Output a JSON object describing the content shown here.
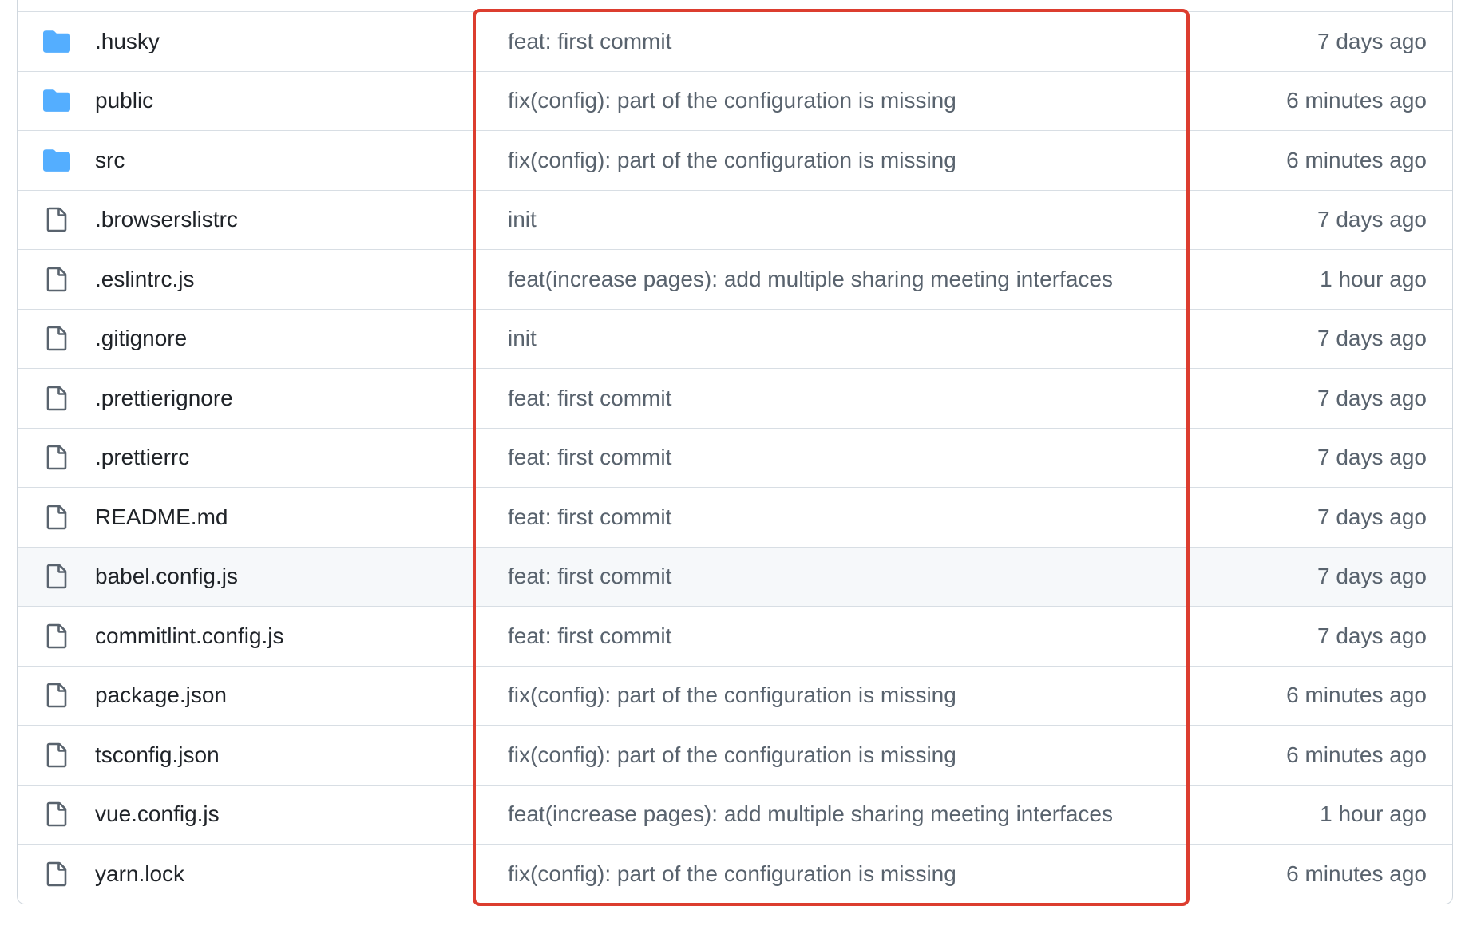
{
  "colors": {
    "folder_icon": "#54aeff",
    "file_icon": "#59636e",
    "highlight_box": "#dc3d2f",
    "row_border": "#d8dee4",
    "hover_row": "#f6f8fa"
  },
  "files": [
    {
      "name": ".husky",
      "type": "folder",
      "icon": "folder-icon",
      "message": "feat: first commit",
      "age": "7 days ago"
    },
    {
      "name": "public",
      "type": "folder",
      "icon": "folder-icon",
      "message": "fix(config): part of the configuration is missing",
      "age": "6 minutes ago"
    },
    {
      "name": "src",
      "type": "folder",
      "icon": "folder-icon",
      "message": "fix(config): part of the configuration is missing",
      "age": "6 minutes ago"
    },
    {
      "name": ".browserslistrc",
      "type": "file",
      "icon": "file-icon",
      "message": "init",
      "age": "7 days ago"
    },
    {
      "name": ".eslintrc.js",
      "type": "file",
      "icon": "file-icon",
      "message": "feat(increase pages): add multiple sharing meeting interfaces",
      "age": "1 hour ago"
    },
    {
      "name": ".gitignore",
      "type": "file",
      "icon": "file-icon",
      "message": "init",
      "age": "7 days ago"
    },
    {
      "name": ".prettierignore",
      "type": "file",
      "icon": "file-icon",
      "message": "feat: first commit",
      "age": "7 days ago"
    },
    {
      "name": ".prettierrc",
      "type": "file",
      "icon": "file-icon",
      "message": "feat: first commit",
      "age": "7 days ago"
    },
    {
      "name": "README.md",
      "type": "file",
      "icon": "file-icon",
      "message": "feat: first commit",
      "age": "7 days ago"
    },
    {
      "name": "babel.config.js",
      "type": "file",
      "icon": "file-icon",
      "message": "feat: first commit",
      "age": "7 days ago"
    },
    {
      "name": "commitlint.config.js",
      "type": "file",
      "icon": "file-icon",
      "message": "feat: first commit",
      "age": "7 days ago"
    },
    {
      "name": "package.json",
      "type": "file",
      "icon": "file-icon",
      "message": "fix(config): part of the configuration is missing",
      "age": "6 minutes ago"
    },
    {
      "name": "tsconfig.json",
      "type": "file",
      "icon": "file-icon",
      "message": "fix(config): part of the configuration is missing",
      "age": "6 minutes ago"
    },
    {
      "name": "vue.config.js",
      "type": "file",
      "icon": "file-icon",
      "message": "feat(increase pages): add multiple sharing meeting interfaces",
      "age": "1 hour ago"
    },
    {
      "name": "yarn.lock",
      "type": "file",
      "icon": "file-icon",
      "message": "fix(config): part of the configuration is missing",
      "age": "6 minutes ago"
    }
  ],
  "hovered_row": "babel.config.js"
}
